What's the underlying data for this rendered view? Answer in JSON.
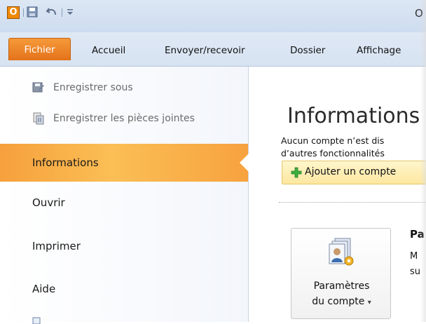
{
  "titlebar": {
    "app_icon_letter": "O",
    "title_partial": "O"
  },
  "tabs": [
    {
      "label": "Fichier"
    },
    {
      "label": "Accueil"
    },
    {
      "label": "Envoyer/recevoir"
    },
    {
      "label": "Dossier"
    },
    {
      "label": "Affichage"
    }
  ],
  "backstage": {
    "commands": [
      {
        "label": "Enregistrer sous",
        "icon": "save-as-icon"
      },
      {
        "label": "Enregistrer les pièces jointes",
        "icon": "save-attachments-icon"
      }
    ],
    "nav": [
      {
        "label": "Informations",
        "selected": true
      },
      {
        "label": "Ouvrir"
      },
      {
        "label": "Imprimer"
      },
      {
        "label": "Aide"
      }
    ]
  },
  "main": {
    "heading": "Informations",
    "description_line1": "Aucun compte n’est dis",
    "description_line2": "d’autres fonctionnalités",
    "add_account_label": "Ajouter un compte",
    "account_settings": {
      "label_line1": "Paramètres",
      "label_line2": "du compte",
      "dropdown_glyph": "▾"
    },
    "side_title": "Pa",
    "side_desc_line1": "M",
    "side_desc_line2": "su"
  },
  "colors": {
    "file_tab": "#e8771f",
    "selected_nav": "#f7a23f",
    "ribbon_bg": "#dae5f3",
    "add_button": "#fde7a0"
  }
}
